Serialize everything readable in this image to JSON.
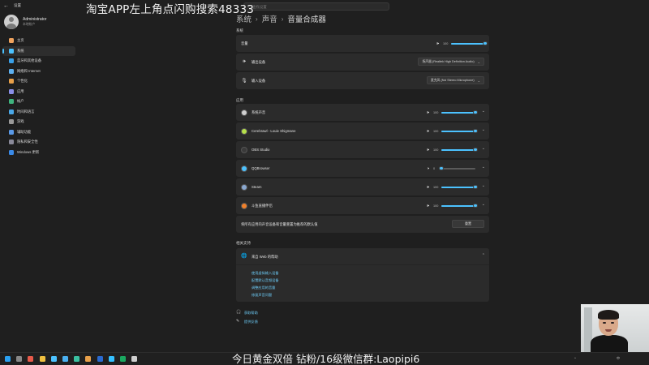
{
  "app": {
    "title": "设置",
    "back": "←"
  },
  "search": {
    "placeholder": "查找设置"
  },
  "overlay": {
    "top": "淘宝APP左上角点闪购搜索48333",
    "bottom": "今日黄金双倍 钻粉/16级微信群:Laopipi6"
  },
  "profile": {
    "name": "Administrator",
    "type": "本地帐户"
  },
  "sidebar": {
    "items": [
      {
        "label": "主页",
        "color": "#f0a35e",
        "active": false
      },
      {
        "label": "系统",
        "color": "#4cc2ff",
        "active": true
      },
      {
        "label": "蓝牙和其他设备",
        "color": "#3aa0e8",
        "active": false
      },
      {
        "label": "网络和 Internet",
        "color": "#5db0f0",
        "active": false
      },
      {
        "label": "个性化",
        "color": "#e8a04a",
        "active": false
      },
      {
        "label": "应用",
        "color": "#8a8fe8",
        "active": false
      },
      {
        "label": "帐户",
        "color": "#3fb47e",
        "active": false
      },
      {
        "label": "时间和语言",
        "color": "#4aa8e8",
        "active": false
      },
      {
        "label": "游戏",
        "color": "#9a9a9a",
        "active": false
      },
      {
        "label": "辅助功能",
        "color": "#5a9ae8",
        "active": false
      },
      {
        "label": "隐私和安全性",
        "color": "#8a8a9a",
        "active": false
      },
      {
        "label": "Windows 更新",
        "color": "#3a8ae8",
        "active": false
      }
    ]
  },
  "breadcrumb": {
    "part1": "系统",
    "sep1": "›",
    "part2": "声音",
    "sep2": "›",
    "part3": "音量合成器"
  },
  "system_section": {
    "label": "系统",
    "volume": {
      "label": "音量",
      "value": "100",
      "level": 100
    },
    "output": {
      "label": "输出设备",
      "value": "扬声器 (Realtek High Definition Audio)"
    },
    "input": {
      "label": "输入设备",
      "value": "麦克风 (Nvi Stereo Microphone)"
    }
  },
  "apps_section": {
    "label": "应用",
    "apps": [
      {
        "label": "系统声音",
        "value": "100",
        "level": 100,
        "icon_color": "#cfcfcf"
      },
      {
        "label": "Cerebrawl - Louie Shigmane",
        "value": "100",
        "level": 100,
        "icon_color": "#b6e04a"
      },
      {
        "label": "OBS Studio",
        "value": "100",
        "level": 100,
        "icon_color": "#3a3a3a"
      },
      {
        "label": "QQBrowser",
        "value": "0",
        "level": 0,
        "icon_color": "#4cc2ff"
      },
      {
        "label": "Steam",
        "value": "100",
        "level": 100,
        "icon_color": "#8aa8d0"
      },
      {
        "label": "斗鱼直播伴侣",
        "value": "100",
        "level": 100,
        "icon_color": "#f0802a"
      }
    ],
    "reset_text": "将所有应用的声音设备和音量重置为推荐的默认值",
    "reset_button": "重置"
  },
  "related": {
    "label": "相关支持",
    "help_title": "来自 Web 的帮助",
    "links": [
      "使用虚拟输入设备",
      "配置默认音频设备",
      "调整应用的音量",
      "修复声音问题"
    ]
  },
  "footer": {
    "get_help": "获取帮助",
    "feedback": "提供反馈"
  },
  "taskbar": {
    "icons": [
      "#2aa0f0",
      "#888888",
      "#e85a4a",
      "#f0c040",
      "#4cc2ff",
      "#4ab0f0",
      "#3ac0a0",
      "#e8a04a",
      "#2a6ad0",
      "#34c0ff",
      "#1aa860",
      "#cfcfcf"
    ],
    "lang": "中",
    "sys_up": "^"
  }
}
